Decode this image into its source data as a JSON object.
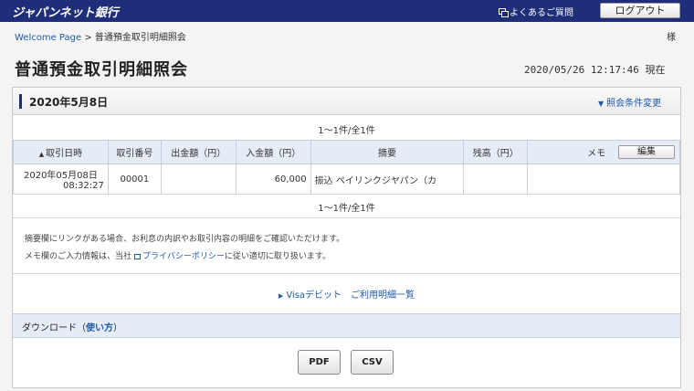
{
  "header": {
    "logo": "ジャパンネット銀行",
    "faq": "よくあるご質問",
    "logout": "ログアウト"
  },
  "breadcrumb": {
    "home": "Welcome Page",
    "separator": ">",
    "current": "普通預金取引明細照会",
    "sama": "様"
  },
  "page": {
    "title": "普通預金取引明細照会",
    "timestamp": "2020/05/26 12:17:46 現在"
  },
  "panel": {
    "date": "2020年5月8日",
    "change_condition": "照会条件変更",
    "count_top": "1～1件/全1件",
    "count_bottom": "1～1件/全1件"
  },
  "table": {
    "headers": {
      "date": "取引日時",
      "number": "取引番号",
      "withdraw": "出金額（円）",
      "deposit": "入金額（円）",
      "summary": "摘要",
      "balance": "残高（円）",
      "memo": "メモ",
      "edit": "編集"
    },
    "rows": [
      {
        "date": "2020年05月08日",
        "time": "08:32:27",
        "number": "00001",
        "withdraw": "",
        "deposit": "60,000",
        "summary": "振込 ペイリンクジヤパン（カ",
        "balance": "",
        "memo": ""
      }
    ]
  },
  "notes": {
    "line1": "摘要欄にリンクがある場合、お利息の内訳やお取引内容の明細をご確認いただけます。",
    "line2_pre": "メモ欄のご入力情報は、当社",
    "line2_link": "プライバシーポリシー",
    "line2_post": "に従い適切に取り扱います。"
  },
  "visa_link": "Visaデビット　ご利用明細一覧",
  "download": {
    "label_pre": "ダウンロード（",
    "label_link": "使い方",
    "label_post": "）",
    "pdf": "PDF",
    "csv": "CSV"
  }
}
